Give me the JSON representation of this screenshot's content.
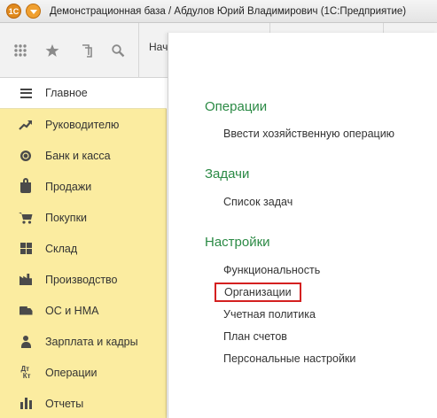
{
  "window": {
    "title": "Демонстрационная база / Абдулов Юрий Владимирович  (1С:Предприятие)",
    "logo_text": "1С"
  },
  "toolbar": {
    "tab_home": "Нач"
  },
  "sidebar": {
    "items": [
      {
        "label": "Главное",
        "icon": "menu-lines-icon",
        "active": true
      },
      {
        "label": "Руководителю",
        "icon": "trend-up-icon"
      },
      {
        "label": "Банк и касса",
        "icon": "coins-icon"
      },
      {
        "label": "Продажи",
        "icon": "shopping-bag-icon"
      },
      {
        "label": "Покупки",
        "icon": "cart-icon"
      },
      {
        "label": "Склад",
        "icon": "warehouse-grid-icon"
      },
      {
        "label": "Производство",
        "icon": "factory-icon"
      },
      {
        "label": "ОС и НМА",
        "icon": "truck-icon"
      },
      {
        "label": "Зарплата и кадры",
        "icon": "person-icon"
      },
      {
        "label": "Операции",
        "icon": "dt-kt-icon"
      },
      {
        "label": "Отчеты",
        "icon": "bar-chart-icon"
      }
    ]
  },
  "main": {
    "sections": [
      {
        "title": "Операции",
        "links": [
          "Ввести хозяйственную операцию"
        ]
      },
      {
        "title": "Задачи",
        "links": [
          "Список задач"
        ]
      },
      {
        "title": "Настройки",
        "links": [
          "Функциональность",
          "Организации",
          "Учетная политика",
          "План счетов",
          "Персональные настройки"
        ]
      }
    ],
    "highlighted_link": "Организации"
  },
  "colors": {
    "sidebar_bg": "#fbeca0",
    "section_title": "#2b8a45",
    "highlight_border": "#d42020",
    "logo": "#e08a1e"
  }
}
